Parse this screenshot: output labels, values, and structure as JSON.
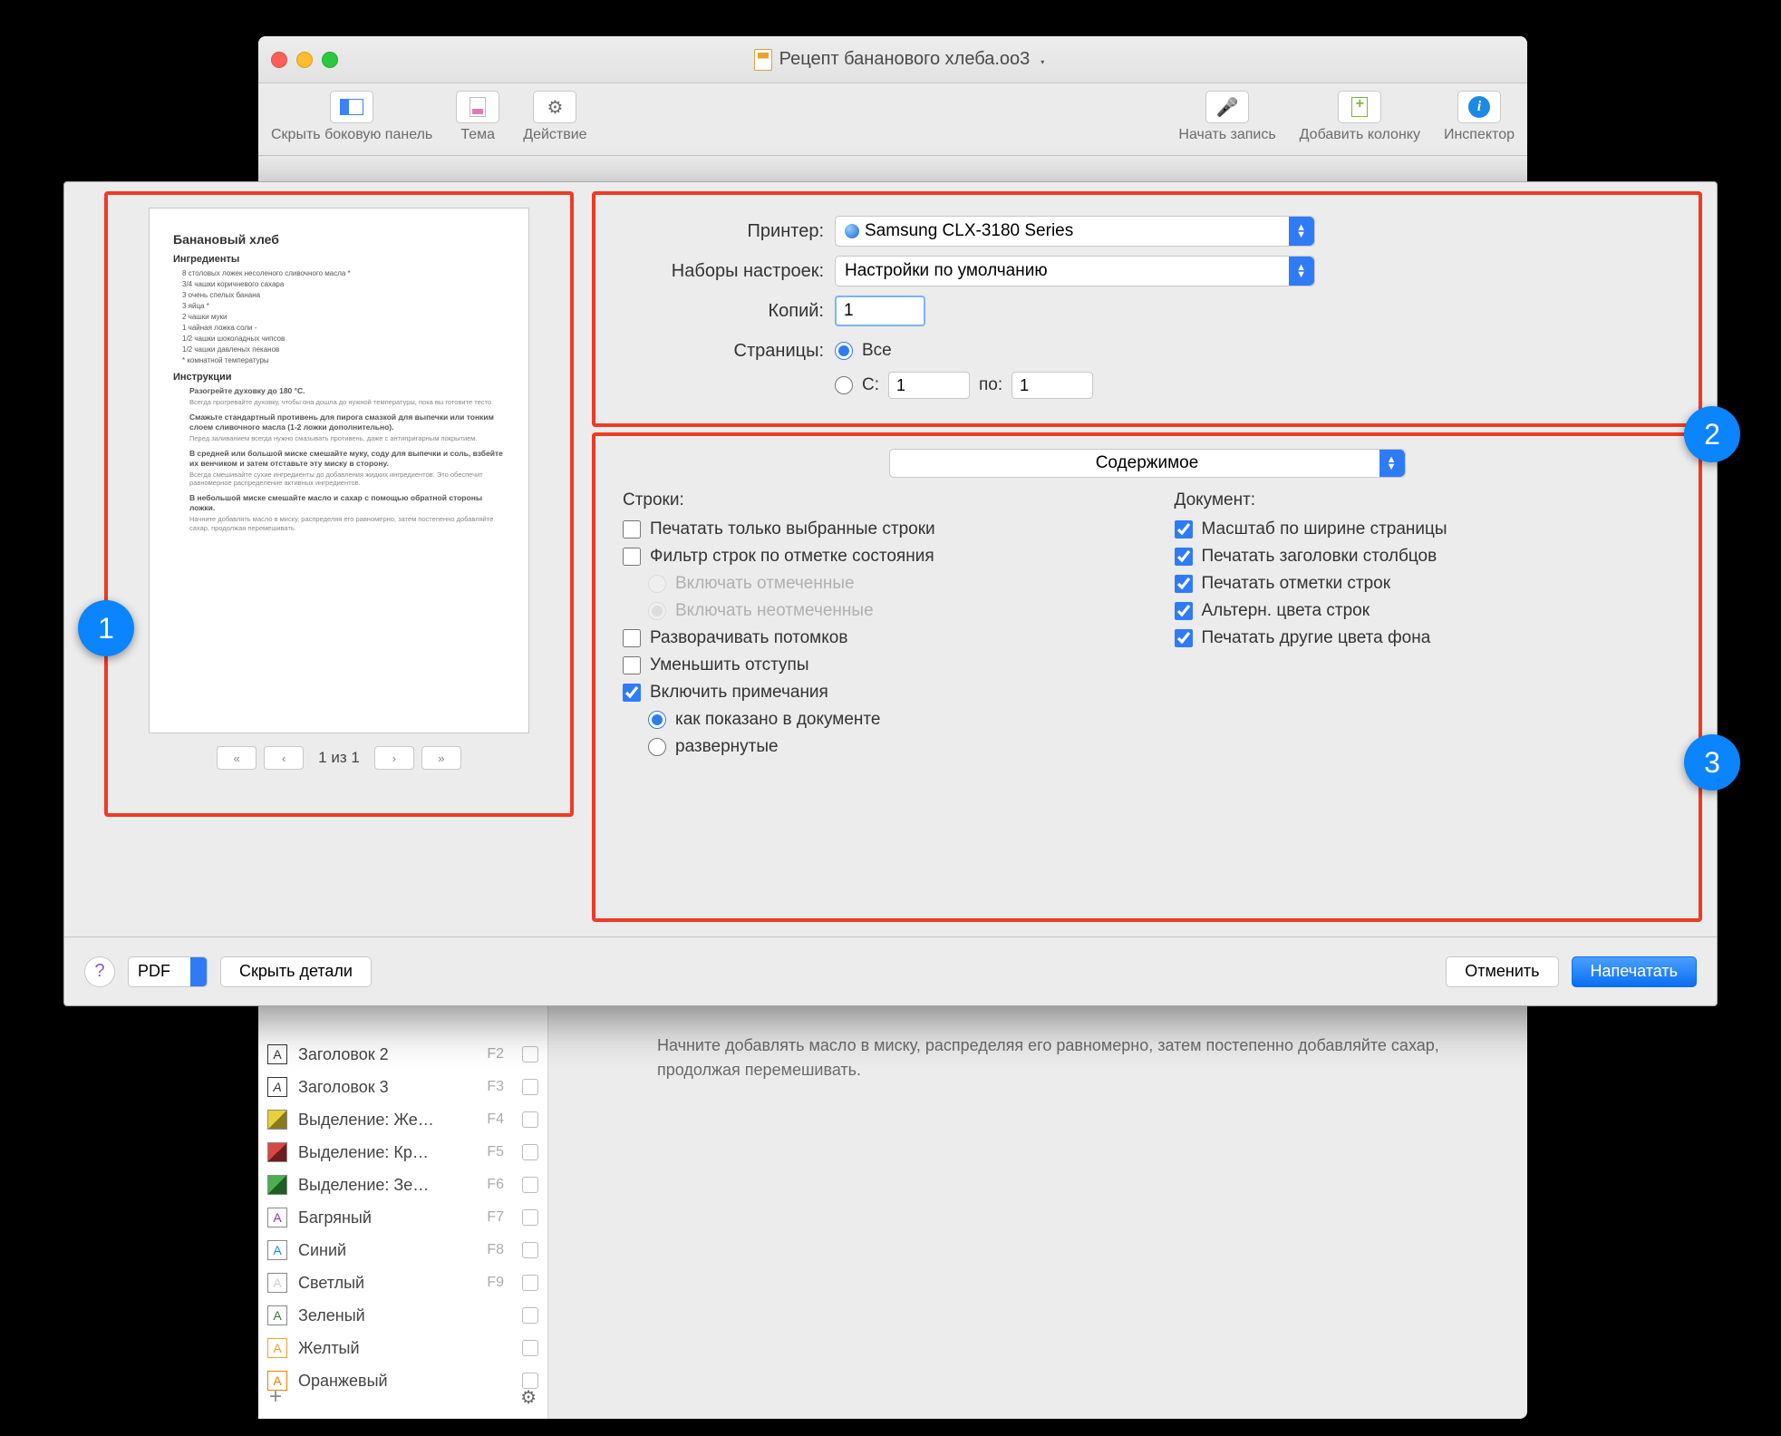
{
  "window": {
    "title": "Рецепт бананового хлеба.oo3"
  },
  "toolbar": {
    "hide_panel": "Скрыть боковую панель",
    "theme": "Тема",
    "action": "Действие",
    "record": "Начать запись",
    "add_column": "Добавить колонку",
    "inspector": "Инспектор"
  },
  "print": {
    "printer_label": "Принтер:",
    "printer_value": "Samsung CLX-3180 Series",
    "preset_label": "Наборы настроек:",
    "preset_value": "Настройки по умолчанию",
    "copies_label": "Копий:",
    "copies_value": "1",
    "pages_label": "Страницы:",
    "pages_all": "Все",
    "pages_from_label": "С:",
    "pages_from": "1",
    "pages_to_label": "по:",
    "pages_to": "1",
    "section_combo": "Содержимое",
    "rows_header": "Строки:",
    "doc_header": "Документ:",
    "rows": {
      "only_selected": "Печатать только выбранные строки",
      "filter_status": "Фильтр строк по отметке состояния",
      "include_checked": "Включать отмеченные",
      "include_unchecked": "Включать неотмеченные",
      "expand_children": "Разворачивать потомков",
      "reduce_indent": "Уменьшить отступы",
      "include_notes": "Включить примечания",
      "notes_as_shown": "как показано в документе",
      "notes_expanded": "развернутые"
    },
    "doc": {
      "fit_width": "Масштаб по ширине страницы",
      "print_headers": "Печатать заголовки столбцов",
      "print_row_marks": "Печатать отметки строк",
      "alt_row_colors": "Альтерн. цвета строк",
      "print_bg_colors": "Печатать другие цвета фона"
    },
    "pager": "1 из 1",
    "help": "?",
    "pdf": "PDF",
    "hide_details": "Скрыть детали",
    "cancel": "Отменить",
    "print_btn": "Напечатать"
  },
  "preview": {
    "title": "Банановый хлеб",
    "ingredients_h": "Ингредиенты",
    "ingredients": [
      "8 столовых ложек несоленого сливочного масла *",
      "3/4 чашки коричневого сахара",
      "3 очень спелых банана",
      "3 яйца *",
      "2 чашки муки",
      "1 чайная ложка соли -",
      "1/2 чашки шоколадных чипсов",
      "1/2 чашки давленых пеканов",
      "* комнатной температуры"
    ],
    "instructions_h": "Инструкции",
    "steps": [
      {
        "t": "Разогрейте духовку до 180 °C.",
        "n": "Всегда прогревайте духовку, чтобы она дошла до нужной температуры, пока вы готовите тесто."
      },
      {
        "t": "Смажьте стандартный противень для пирога смазкой для выпечки или тонким слоем сливочного масла (1-2 ложки дополнительно).",
        "n": "Перед заливанием всегда нужно смазывать противень, даже с антипригарным покрытием."
      },
      {
        "t": "В средней или большой миске смешайте муку, соду для выпечки и соль, взбейте их венчиком и затем отставьте эту миску в сторону.",
        "n": "Всегда смешивайте сухие ингредиенты до добавления жидких ингредиентов. Это обеспечит равномерное распределение активных ингредиентов."
      },
      {
        "t": "В небольшой миске смешайте масло и сахар с помощью обратной стороны ложки.",
        "n": "Начните добавлять масло в миску, распределяя его равномерно, затем постепенно добавляйте сахар, продолжая перемешивать."
      }
    ]
  },
  "callouts": {
    "c1": "1",
    "c2": "2",
    "c3": "3"
  },
  "styles": [
    {
      "label": "Заголовок 2",
      "key": "F2",
      "color": "#fff",
      "txt": "А",
      "border": "#333"
    },
    {
      "label": "Заголовок 3",
      "key": "F3",
      "color": "#fff",
      "txt": "А",
      "border": "#333",
      "italic": true
    },
    {
      "label": "Выделение: Же…",
      "key": "F4",
      "color": "linear-gradient(135deg,#e8d13b 50%,#8a7a1e 50%)",
      "txt": ""
    },
    {
      "label": "Выделение: Кр…",
      "key": "F5",
      "color": "linear-gradient(135deg,#d64848 50%,#6e1e1e 50%)",
      "txt": ""
    },
    {
      "label": "Выделение: Зе…",
      "key": "F6",
      "color": "linear-gradient(135deg,#4caf50 50%,#1e5e21 50%)",
      "txt": ""
    },
    {
      "label": "Багряный",
      "key": "F7",
      "color": "#fff",
      "txt": "А",
      "tc": "#9b2fae"
    },
    {
      "label": "Синий",
      "key": "F8",
      "color": "#fff",
      "txt": "А",
      "tc": "#1e88e5"
    },
    {
      "label": "Светлый",
      "key": "F9",
      "color": "#fff",
      "txt": "А",
      "tc": "#cfcfcf"
    },
    {
      "label": "Зеленый",
      "key": "",
      "color": "#fff",
      "txt": "А",
      "tc": "#2e7d32"
    },
    {
      "label": "Желтый",
      "key": "",
      "color": "#fff",
      "txt": "А",
      "tc": "#f0a030",
      "border": "#f0a030"
    },
    {
      "label": "Оранжевый",
      "key": "",
      "color": "#fff",
      "txt": "А",
      "tc": "#f57c00",
      "border": "#f57c00"
    }
  ],
  "main_note": "Начните добавлять масло в миску, распределяя его равномерно, затем постепенно добавляйте сахар, продолжая перемешивать."
}
